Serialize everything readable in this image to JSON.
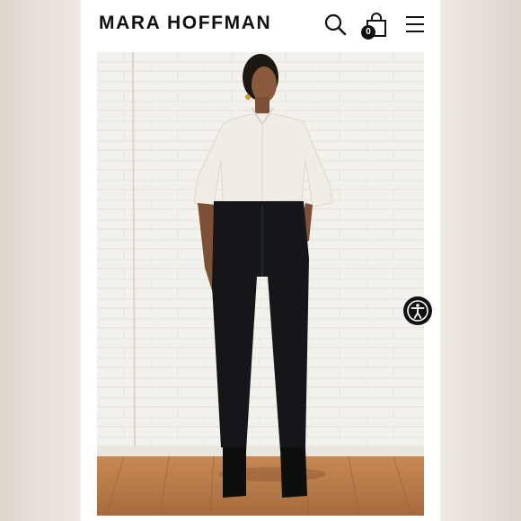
{
  "header": {
    "brand": "MARA HOFFMAN",
    "cart_count": "0",
    "icons": [
      "search-icon",
      "shopping-bag-icon",
      "hamburger-menu-icon"
    ]
  },
  "product_image": {
    "subject": "model-photo"
  },
  "accessibility": {
    "icon": "accessibility-icon"
  },
  "colors": {
    "brand_text": "#111111",
    "header_bg": "#ffffff",
    "accessibility_button": "#111111"
  }
}
